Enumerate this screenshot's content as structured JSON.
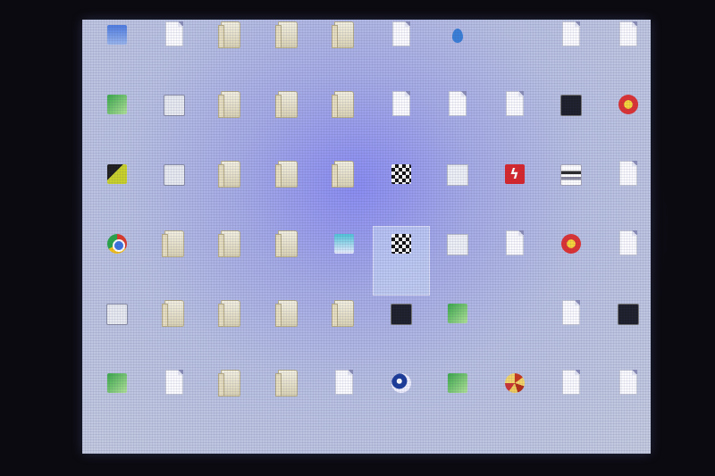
{
  "desktop": {
    "icons": [
      {
        "label": "",
        "glyph": "blue"
      },
      {
        "label": "",
        "glyph": "doc"
      },
      {
        "label": "",
        "glyph": "folder"
      },
      {
        "label": "",
        "glyph": "folder"
      },
      {
        "label": "",
        "glyph": "folder"
      },
      {
        "label": "",
        "glyph": "doc"
      },
      {
        "label": "",
        "glyph": "drop"
      },
      {
        "label": "",
        "glyph": "app"
      },
      {
        "label": "",
        "glyph": "doc"
      },
      {
        "label": "",
        "glyph": "doc"
      },
      {
        "label": "",
        "glyph": "green"
      },
      {
        "label": "",
        "glyph": "word"
      },
      {
        "label": "",
        "glyph": "folder"
      },
      {
        "label": "",
        "glyph": "folder"
      },
      {
        "label": "",
        "glyph": "folder"
      },
      {
        "label": "",
        "glyph": "doc"
      },
      {
        "label": "",
        "glyph": "doc"
      },
      {
        "label": "",
        "glyph": "doc"
      },
      {
        "label": "",
        "glyph": "dark"
      },
      {
        "label": "",
        "glyph": "red"
      },
      {
        "label": "",
        "glyph": "yellowgreen"
      },
      {
        "label": "",
        "glyph": "word"
      },
      {
        "label": "",
        "glyph": "folder"
      },
      {
        "label": "",
        "glyph": "folder"
      },
      {
        "label": "",
        "glyph": "folder"
      },
      {
        "label": "",
        "glyph": "chess"
      },
      {
        "label": "",
        "glyph": "box"
      },
      {
        "label": "",
        "glyph": "flash"
      },
      {
        "label": "",
        "glyph": "stripes"
      },
      {
        "label": "",
        "glyph": "doc"
      },
      {
        "label": "",
        "glyph": "chrome"
      },
      {
        "label": "",
        "glyph": "folder"
      },
      {
        "label": "",
        "glyph": "folder"
      },
      {
        "label": "",
        "glyph": "folder"
      },
      {
        "label": "",
        "glyph": "cyan"
      },
      {
        "label": "",
        "glyph": "chess"
      },
      {
        "label": "",
        "glyph": "box"
      },
      {
        "label": "",
        "glyph": "doc"
      },
      {
        "label": "",
        "glyph": "red"
      },
      {
        "label": "",
        "glyph": "doc"
      },
      {
        "label": "",
        "glyph": "word"
      },
      {
        "label": "",
        "glyph": "folder"
      },
      {
        "label": "",
        "glyph": "folder"
      },
      {
        "label": "",
        "glyph": "folder"
      },
      {
        "label": "",
        "glyph": "folder"
      },
      {
        "label": "",
        "glyph": "dark"
      },
      {
        "label": "",
        "glyph": "green"
      },
      {
        "label": "",
        "glyph": "app"
      },
      {
        "label": "",
        "glyph": "doc"
      },
      {
        "label": "",
        "glyph": "dark"
      },
      {
        "label": "",
        "glyph": "green"
      },
      {
        "label": "",
        "glyph": "doc"
      },
      {
        "label": "",
        "glyph": "folder"
      },
      {
        "label": "",
        "glyph": "folder"
      },
      {
        "label": "",
        "glyph": "doc"
      },
      {
        "label": "",
        "glyph": "game"
      },
      {
        "label": "",
        "glyph": "green"
      },
      {
        "label": "",
        "glyph": "pizza"
      },
      {
        "label": "",
        "glyph": "doc"
      },
      {
        "label": "",
        "glyph": "doc"
      }
    ],
    "selected_index": 35
  }
}
